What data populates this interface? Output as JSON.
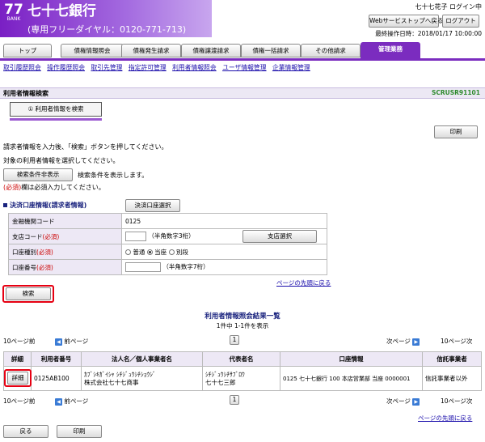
{
  "header": {
    "logo_num": "77",
    "logo_sub": "BANK",
    "bank_name": "七十七銀行",
    "phone_label": "(専用フリーダイヤル：0120-771-713)",
    "user_line": "七十七花子 ログイン中",
    "web_top_btn": "Webサービストップへ戻る",
    "logout_btn": "ログアウト",
    "last_login": "最終操作日時：2018/01/17 10:00:00"
  },
  "tabs": [
    "トップ",
    "債権情報照会",
    "債権発生請求",
    "債権譲渡請求",
    "債権一括請求",
    "その他請求",
    "管理業務"
  ],
  "subnav": [
    "取引履歴照会",
    "操作履歴照会",
    "取引先管理",
    "指定許可管理",
    "利用者情報照会",
    "ユーザ情報管理",
    "企業情報管理"
  ],
  "page": {
    "title": "利用者情報検索",
    "screen_id": "SCRUSR91101",
    "step": "① 利用者情報を検索",
    "print_btn": "印刷",
    "instruction1": "請求者情報を入力後、「検索」ボタンを押してください。",
    "instruction2": "対象の利用者情報を選択してください。",
    "cond_btn": "検索条件非表示",
    "cond_text": "検索条件を表示します。",
    "req_mark": "(必須)",
    "req_text": "欄は必須入力してください。"
  },
  "account": {
    "heading": "決済口座情報(請求者情報)",
    "select_btn": "決済口座選択",
    "rows": [
      {
        "label": "金融機関コード",
        "value": "0125"
      },
      {
        "label": "支店コード",
        "req": "(必須)",
        "hint": "（半角数字3桁）",
        "btn": "支店選択"
      },
      {
        "label": "口座種別",
        "req": "(必須)",
        "opt1": "普通",
        "opt2": "当座",
        "opt3": "別段"
      },
      {
        "label": "口座番号",
        "req": "(必須)",
        "hint": "（半角数字7桁）"
      }
    ],
    "to_top": "ページの先頭に戻る"
  },
  "search_btn": "検索",
  "results": {
    "title": "利用者情報照会結果一覧",
    "count": "1件中 1-1件を表示",
    "prev10": "10ページ前",
    "prev": "前ページ",
    "page": "1",
    "next": "次ページ",
    "next10": "10ページ次",
    "headers": [
      "詳細",
      "利用者番号",
      "法人名／個人事業者名",
      "代表者名",
      "口座情報",
      "信託事業者"
    ],
    "row": {
      "detail_btn": "詳細",
      "user_no": "0125AB100",
      "name1": "ｶﾌﾞｼｷｶﾞｲｼｬ ｼﾁｼﾞｭｳｼﾁｼｮｳｼﾞ",
      "name2": "株式会社七十七商事",
      "rep1": "ｼﾁｼﾞｭｳｼﾁｻﾌﾞﾛｳ",
      "rep2": "七十七三郎",
      "account": "0125 七十七銀行 100 本店営業部 当座 0000001",
      "trust": "信託事業者以外"
    },
    "to_top": "ページの先頭に戻る"
  },
  "footer": {
    "back_btn": "戻る",
    "print_btn": "印刷"
  }
}
